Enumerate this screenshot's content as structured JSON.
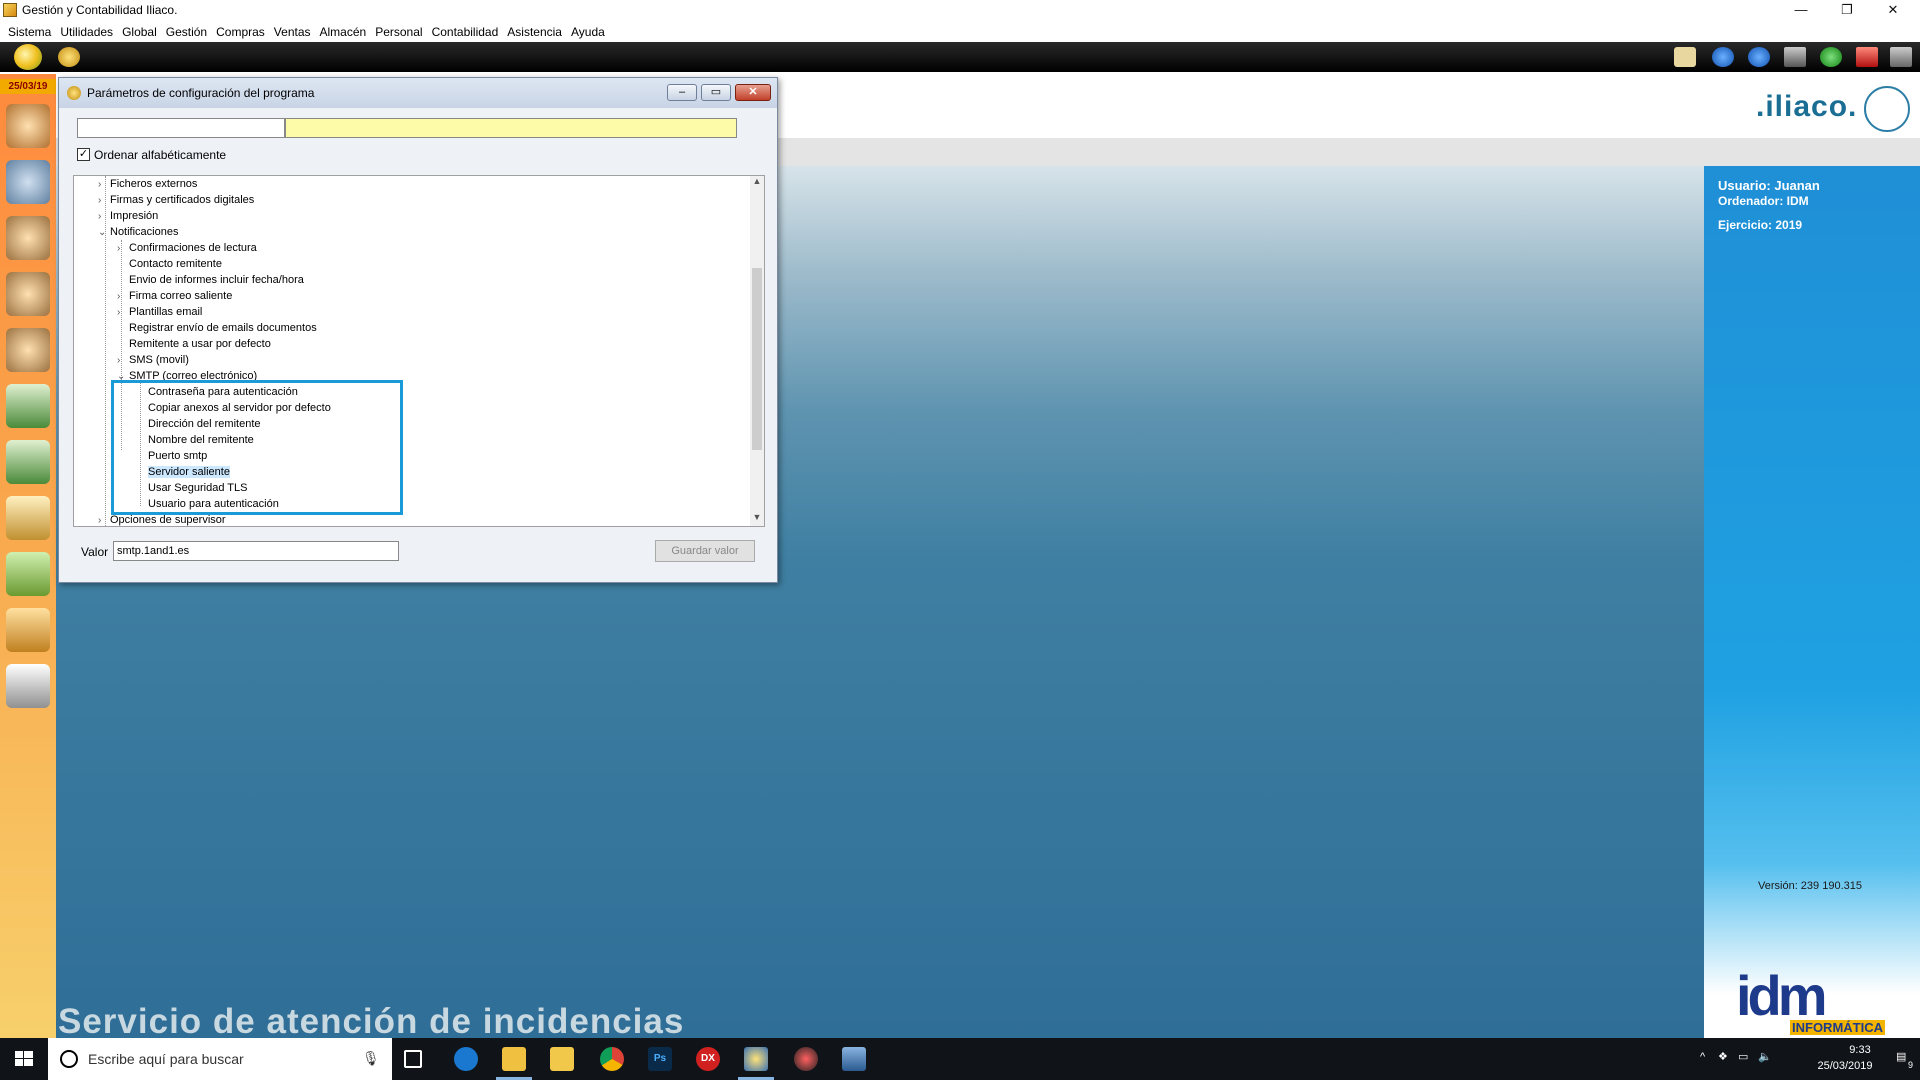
{
  "window": {
    "title": "Gestión y Contabilidad Iliaco.",
    "minimize": "—",
    "restore": "❐",
    "close": "✕"
  },
  "menu": [
    "Sistema",
    "Utilidades",
    "Global",
    "Gestión",
    "Compras",
    "Ventas",
    "Almacén",
    "Personal",
    "Contabilidad",
    "Asistencia",
    "Ayuda"
  ],
  "date_badge": "25/03/19",
  "brand": {
    "logo": ".iliaco.",
    "accent": "#1b6e93"
  },
  "user_panel": {
    "usuario": "Usuario: Juanan",
    "ordenador": "Ordenador: IDM",
    "ejercicio": "Ejercicio: 2019",
    "version": "Versión: 239 190.315"
  },
  "footer": {
    "service": "Servicio de atención de incidencias",
    "idm": "idm",
    "idm_sub": "INFORMÁTICA"
  },
  "dialog": {
    "title": "Parámetros de configuración del programa",
    "sort_label": "Ordenar alfabéticamente",
    "sort_checked": "✓",
    "valor_label": "Valor",
    "valor_value": "smtp.1and1.es",
    "save_label": "Guardar valor",
    "tree": {
      "ficheros": "Ficheros externos",
      "firmas": "Firmas y certificados digitales",
      "impresion": "Impresión",
      "notificaciones": "Notificaciones",
      "confirmaciones": "Confirmaciones de lectura",
      "contacto": "Contacto remitente",
      "envio": "Envio de informes incluir fecha/hora",
      "firma_correo": "Firma correo saliente",
      "plantillas": "Plantillas email",
      "registrar": "Registrar envío de emails documentos",
      "remitente": "Remitente a usar por defecto",
      "sms": "SMS (movil)",
      "smtp": "SMTP (correo electrónico)",
      "contrasena": "Contraseña para autenticación",
      "copiar": "Copiar anexos al servidor por defecto",
      "direccion": "Dirección del remitente",
      "nombre": "Nombre del remitente",
      "puerto": "Puerto smtp",
      "servidor": "Servidor saliente",
      "tls": "Usar Seguridad TLS",
      "usuario": "Usuario para autenticación",
      "opciones": "Opciones de supervisor"
    }
  },
  "taskbar": {
    "search_placeholder": "Escribe aquí para buscar",
    "time": "9:33",
    "date": "25/03/2019",
    "notifications": "9"
  }
}
